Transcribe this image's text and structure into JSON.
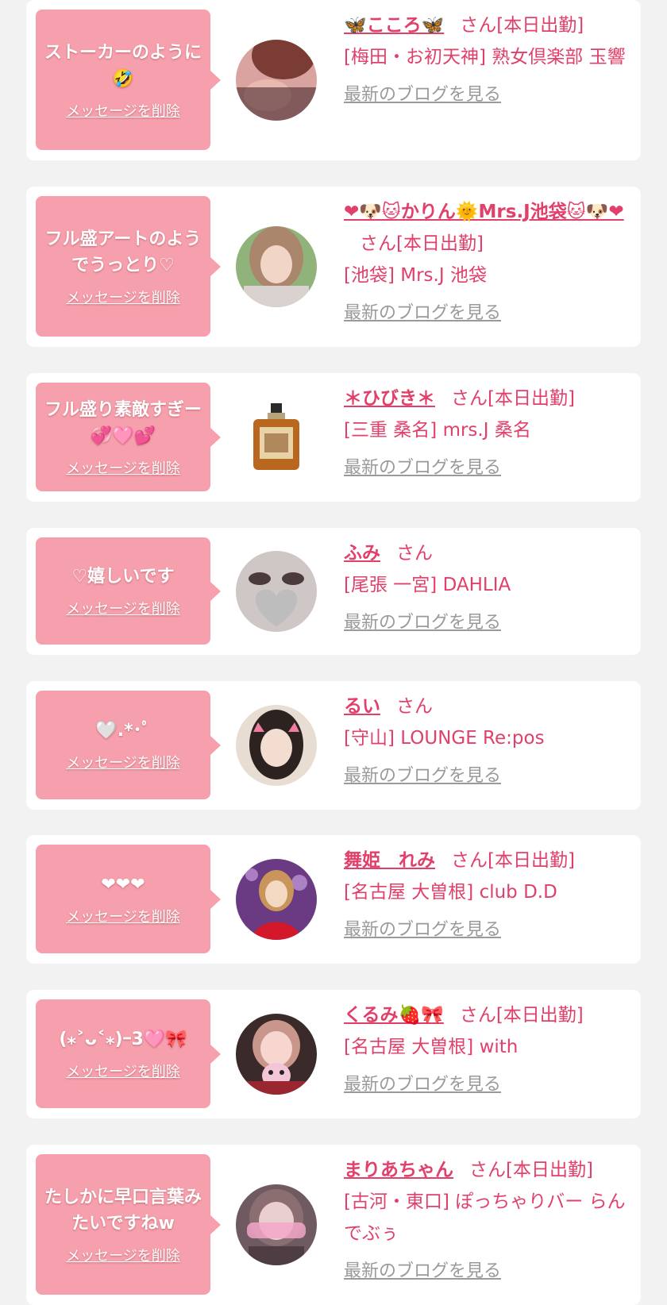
{
  "delete_label": "メッセージを削除",
  "blog_label": "最新のブログを見る",
  "colors": {
    "page_bg": "#f2f2f2",
    "card_bg": "#ffffff",
    "bubble_bg": "#f7a0ad",
    "name_text": "#e0406a",
    "blog_link": "#9a9a9a"
  },
  "items": [
    {
      "message": "ストーカーのように🤣",
      "name": "🦋こころ🦋",
      "suffix": "さん[本日出勤]",
      "shop": "[梅田・お初天神] 熟女倶楽部 玉響"
    },
    {
      "message": "フル盛アートのようでうっとり♡",
      "name": "❤🐶🐱かりん🌞Mrs.J池袋🐱🐶❤",
      "suffix": "さん[本日出勤]",
      "shop": "[池袋] Mrs.J 池袋"
    },
    {
      "message": "フル盛り素敵すぎー💞🩷💕",
      "name": "＊ひびき＊",
      "suffix": "さん[本日出勤]",
      "shop": "[三重 桑名] mrs.J 桑名"
    },
    {
      "message": "♡嬉しいです",
      "name": "ふみ",
      "suffix": "さん",
      "shop": "[尾張 一宮] DAHLIA"
    },
    {
      "message": "🤍.*･ﾟ",
      "name": "るい",
      "suffix": "さん",
      "shop": "[守山] LOUNGE Re:pos"
    },
    {
      "message": "❤❤❤",
      "name": "舞姫　れみ",
      "suffix": "さん[本日出勤]",
      "shop": "[名古屋 大曽根] club D.D"
    },
    {
      "message": "(⁎˃ᴗ˂⁎)ｰ3🩷🎀",
      "name": "くるみ🍓🎀",
      "suffix": "さん[本日出勤]",
      "shop": "[名古屋 大曽根] with"
    },
    {
      "message": "たしかに早口言葉みたいですねw",
      "name": "まりあちゃん",
      "suffix": "さん[本日出勤]",
      "shop": "[古河・東口] ぽっちゃりバー らんでぶぅ"
    }
  ]
}
